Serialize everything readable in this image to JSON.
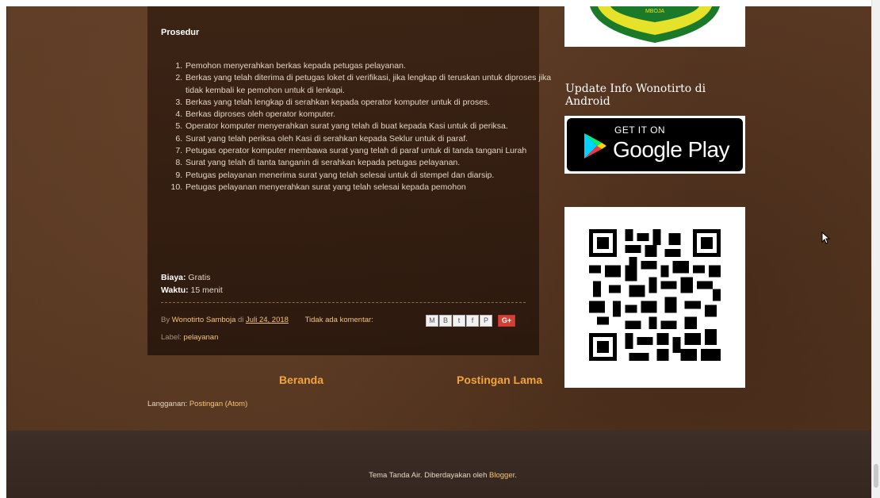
{
  "post": {
    "heading": "Prosedur",
    "steps": [
      "Pemohon menyerahkan berkas kepada  petugas pelayanan.",
      "Berkas yang telah diterima di petugas loket di verifikasi, jika lengkap di teruskan untuk diproses jika tidak kembali ke pemohon untuk di lenkapi.",
      "Berkas yang telah lengkap di serahkan kepada operator komputer untuk di proses.",
      "Berkas diproses oleh operator komputer.",
      "Operator komputer  menyerahkan surat yang telah di buat kepada Kasi untuk di periksa.",
      "Surat yang telah periksa oleh Kasi di serahkan kepada Seklur untuk di paraf.",
      "Petugas operator komputer membawa surat yang telah di paraf untuk di tanda tangani Lurah",
      "Surat yang telah di tanta tanganin di serahkan kepada petugas pelayanan.",
      "Petugas pelayanan menerima surat yang telah selesai untuk di stempel dan diarsip.",
      "Petugas pelayanan menyerahkan surat yang telah selesai kepada pemohon"
    ],
    "biaya_label": "Biaya:",
    "biaya_value": " Gratis",
    "waktu_label": "Waktu:",
    "waktu_value": " 15 menit",
    "by_prefix": "By ",
    "author": "Wonotirto Samboja",
    "di": " di ",
    "date": "Juli 24, 2018",
    "comments": "Tidak ada komentar:",
    "label_prefix": "Label: ",
    "label": "pelayanan",
    "share_icons": [
      "M",
      "B",
      "t",
      "f",
      "P"
    ],
    "gplus": "G+"
  },
  "pager": {
    "home": "Beranda",
    "older": "Postingan Lama"
  },
  "subscribe": {
    "prefix": "Langganan: ",
    "link": "Postingan (Atom)"
  },
  "sidebar": {
    "logo_text": "MBOJA",
    "android_title": "Update Info Wonotirto di Android",
    "gplay_small": "GET IT ON",
    "gplay_big": "Google Play"
  },
  "footer": {
    "text": "Tema Tanda Air. Diberdayakan oleh ",
    "link": "Blogger",
    "suffix": "."
  },
  "colors": {
    "accent": "#f3a43a",
    "link": "#f3c47a",
    "background": "#5a3a24"
  }
}
